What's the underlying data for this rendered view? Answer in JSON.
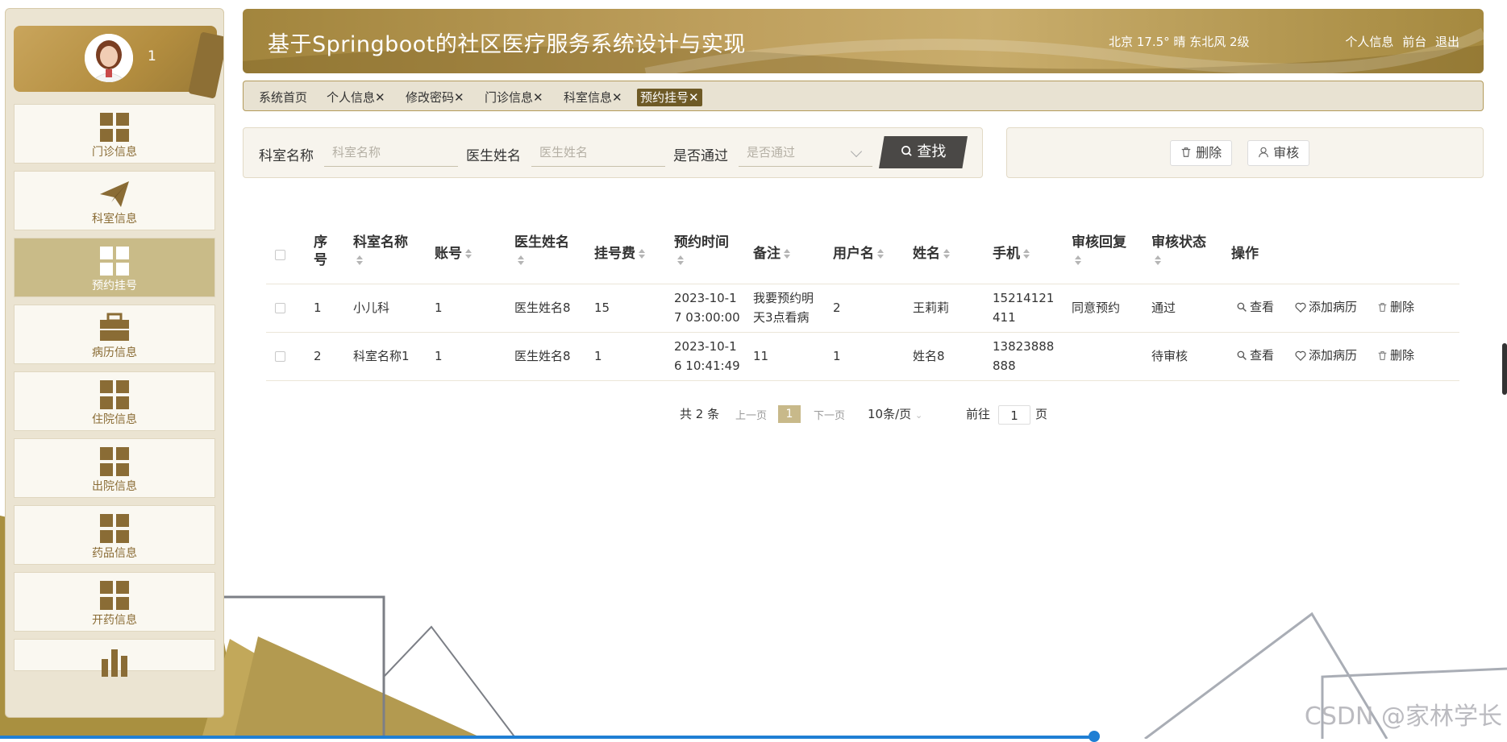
{
  "app": {
    "title": "基于Springboot的社区医疗服务系统设计与实现",
    "weather": "北京 17.5° 晴 东北风 2级",
    "top_links": [
      "个人信息",
      "前台",
      "退出"
    ]
  },
  "user": {
    "name": "1"
  },
  "sidebar": {
    "items": [
      {
        "label": "门诊信息",
        "icon": "grid-icon"
      },
      {
        "label": "科室信息",
        "icon": "paper-plane-icon"
      },
      {
        "label": "预约挂号",
        "icon": "grid-icon",
        "active": true
      },
      {
        "label": "病历信息",
        "icon": "briefcase-icon"
      },
      {
        "label": "住院信息",
        "icon": "grid-icon"
      },
      {
        "label": "出院信息",
        "icon": "grid-icon"
      },
      {
        "label": "药品信息",
        "icon": "grid-icon"
      },
      {
        "label": "开药信息",
        "icon": "grid-icon"
      },
      {
        "label": "",
        "icon": "bar-chart-icon"
      }
    ]
  },
  "tags": [
    {
      "label": "系统首页"
    },
    {
      "label": "个人信息✕"
    },
    {
      "label": "修改密码✕"
    },
    {
      "label": "门诊信息✕"
    },
    {
      "label": "科室信息✕"
    },
    {
      "label": "预约挂号✕",
      "active": true
    }
  ],
  "search": {
    "dept_label": "科室名称",
    "dept_placeholder": "科室名称",
    "doctor_label": "医生姓名",
    "doctor_placeholder": "医生姓名",
    "pass_label": "是否通过",
    "pass_placeholder": "是否通过",
    "button": "查找"
  },
  "actions": {
    "delete": "删除",
    "audit": "审核"
  },
  "table": {
    "headers": {
      "seq": "序号",
      "dept": "科室名称",
      "account": "账号",
      "doctor": "医生姓名",
      "fee": "挂号费",
      "time": "预约时间",
      "remark": "备注",
      "username": "用户名",
      "name": "姓名",
      "phone": "手机",
      "reply": "审核回复",
      "status": "审核状态",
      "ops": "操作"
    },
    "rows": [
      {
        "seq": "1",
        "dept": "小儿科",
        "account": "1",
        "doctor": "医生姓名8",
        "fee": "15",
        "time_l1": "2023-10-1",
        "time_l2": "7 03:00:00",
        "remark_l1": "我要预约明",
        "remark_l2": "天3点看病",
        "username": "2",
        "name": "王莉莉",
        "phone_l1": "15214121",
        "phone_l2": "411",
        "reply": "同意预约",
        "status": "通过"
      },
      {
        "seq": "2",
        "dept": "科室名称1",
        "account": "1",
        "doctor": "医生姓名8",
        "fee": "1",
        "time_l1": "2023-10-1",
        "time_l2": "6 10:41:49",
        "remark_l1": "11",
        "remark_l2": "",
        "username": "1",
        "name": "姓名8",
        "phone_l1": "13823888",
        "phone_l2": "888",
        "reply": "",
        "status": "待审核"
      }
    ],
    "ops": {
      "view": "查看",
      "add_record": "添加病历",
      "delete": "删除"
    }
  },
  "pagination": {
    "total": "共 2 条",
    "prev": "上一页",
    "current": "1",
    "next": "下一页",
    "page_size": "10条/页",
    "goto_prefix": "前往",
    "goto_value": "1",
    "goto_suffix": "页"
  },
  "watermark": "CSDN @家林学长",
  "colors": {
    "brand": "#a2853d",
    "active_menu": "#c9bb88",
    "active_tag": "#6e5a26",
    "search_button": "#4a4846"
  }
}
